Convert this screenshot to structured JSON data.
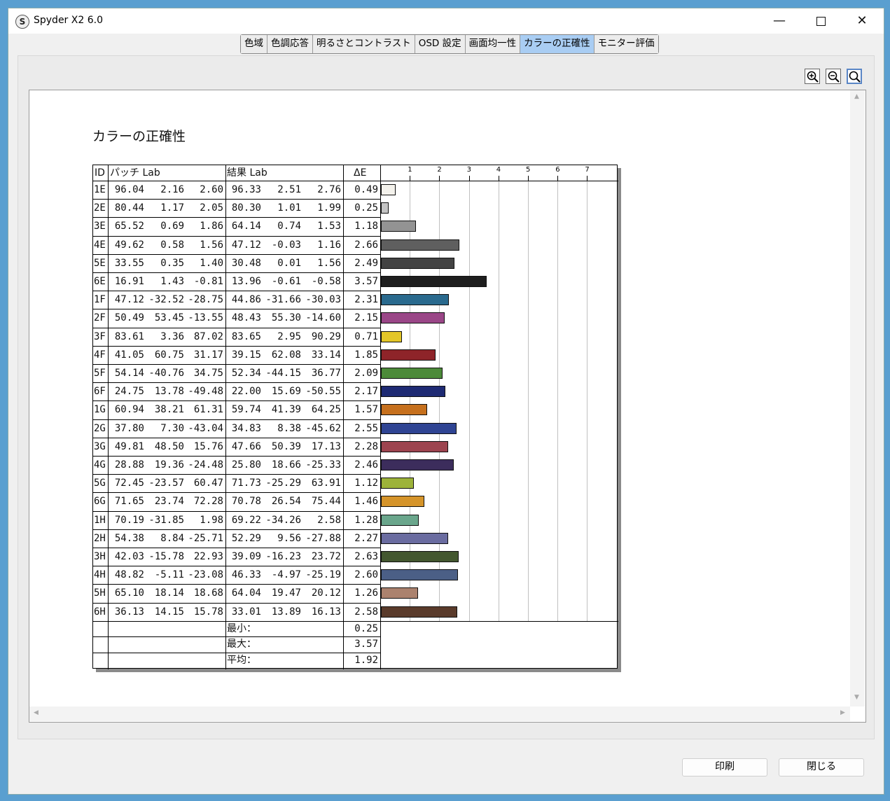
{
  "window": {
    "title": "Spyder X2 6.0",
    "app_icon": "S"
  },
  "tabs": [
    "色域",
    "色調応答",
    "明るさとコントラスト",
    "OSD 設定",
    "画面均一性",
    "カラーの正確性",
    "モニター評価"
  ],
  "active_tab": "カラーの正確性",
  "report": {
    "title": "カラーの正確性",
    "headers": {
      "id": "ID",
      "patch": "パッチ Lab",
      "result": "結果 Lab",
      "de": "ΔE"
    },
    "scale": {
      "ticks": [
        "1",
        "2",
        "3",
        "4",
        "5",
        "6",
        "7"
      ],
      "max": 7.5
    },
    "rows": [
      {
        "id": "1E",
        "p": [
          "96.04",
          "2.16",
          "2.60"
        ],
        "r": [
          "96.33",
          "2.51",
          "2.76"
        ],
        "de": "0.49",
        "color": "#f4f2ec"
      },
      {
        "id": "2E",
        "p": [
          "80.44",
          "1.17",
          "2.05"
        ],
        "r": [
          "80.30",
          "1.01",
          "1.99"
        ],
        "de": "0.25",
        "color": "#c4c4c4"
      },
      {
        "id": "3E",
        "p": [
          "65.52",
          "0.69",
          "1.86"
        ],
        "r": [
          "64.14",
          "0.74",
          "1.53"
        ],
        "de": "1.18",
        "color": "#939393"
      },
      {
        "id": "4E",
        "p": [
          "49.62",
          "0.58",
          "1.56"
        ],
        "r": [
          "47.12",
          "-0.03",
          "1.16"
        ],
        "de": "2.66",
        "color": "#5f5f5f"
      },
      {
        "id": "5E",
        "p": [
          "33.55",
          "0.35",
          "1.40"
        ],
        "r": [
          "30.48",
          "0.01",
          "1.56"
        ],
        "de": "2.49",
        "color": "#434343"
      },
      {
        "id": "6E",
        "p": [
          "16.91",
          "1.43",
          "-0.81"
        ],
        "r": [
          "13.96",
          "-0.61",
          "-0.58"
        ],
        "de": "3.57",
        "color": "#1e1e1e"
      },
      {
        "id": "1F",
        "p": [
          "47.12",
          "-32.52",
          "-28.75"
        ],
        "r": [
          "44.86",
          "-31.66",
          "-30.03"
        ],
        "de": "2.31",
        "color": "#2a6a8e"
      },
      {
        "id": "2F",
        "p": [
          "50.49",
          "53.45",
          "-13.55"
        ],
        "r": [
          "48.43",
          "55.30",
          "-14.60"
        ],
        "de": "2.15",
        "color": "#9a4687"
      },
      {
        "id": "3F",
        "p": [
          "83.61",
          "3.36",
          "87.02"
        ],
        "r": [
          "83.65",
          "2.95",
          "90.29"
        ],
        "de": "0.71",
        "color": "#e3c628"
      },
      {
        "id": "4F",
        "p": [
          "41.05",
          "60.75",
          "31.17"
        ],
        "r": [
          "39.15",
          "62.08",
          "33.14"
        ],
        "de": "1.85",
        "color": "#8e2429"
      },
      {
        "id": "5F",
        "p": [
          "54.14",
          "-40.76",
          "34.75"
        ],
        "r": [
          "52.34",
          "-44.15",
          "36.77"
        ],
        "de": "2.09",
        "color": "#4c8a39"
      },
      {
        "id": "6F",
        "p": [
          "24.75",
          "13.78",
          "-49.48"
        ],
        "r": [
          "22.00",
          "15.69",
          "-50.55"
        ],
        "de": "2.17",
        "color": "#1e2a73"
      },
      {
        "id": "1G",
        "p": [
          "60.94",
          "38.21",
          "61.31"
        ],
        "r": [
          "59.74",
          "41.39",
          "64.25"
        ],
        "de": "1.57",
        "color": "#c6701d"
      },
      {
        "id": "2G",
        "p": [
          "37.80",
          "7.30",
          "-43.04"
        ],
        "r": [
          "34.83",
          "8.38",
          "-45.62"
        ],
        "de": "2.55",
        "color": "#2f4493"
      },
      {
        "id": "3G",
        "p": [
          "49.81",
          "48.50",
          "15.76"
        ],
        "r": [
          "47.66",
          "50.39",
          "17.13"
        ],
        "de": "2.28",
        "color": "#9d444f"
      },
      {
        "id": "4G",
        "p": [
          "28.88",
          "19.36",
          "-24.48"
        ],
        "r": [
          "25.80",
          "18.66",
          "-25.33"
        ],
        "de": "2.46",
        "color": "#3c2d5c"
      },
      {
        "id": "5G",
        "p": [
          "72.45",
          "-23.57",
          "60.47"
        ],
        "r": [
          "71.73",
          "-25.29",
          "63.91"
        ],
        "de": "1.12",
        "color": "#9db33a"
      },
      {
        "id": "6G",
        "p": [
          "71.65",
          "23.74",
          "72.28"
        ],
        "r": [
          "70.78",
          "26.54",
          "75.44"
        ],
        "de": "1.46",
        "color": "#d5942a"
      },
      {
        "id": "1H",
        "p": [
          "70.19",
          "-31.85",
          "1.98"
        ],
        "r": [
          "69.22",
          "-34.26",
          "2.58"
        ],
        "de": "1.28",
        "color": "#6aa68c"
      },
      {
        "id": "2H",
        "p": [
          "54.38",
          "8.84",
          "-25.71"
        ],
        "r": [
          "52.29",
          "9.56",
          "-27.88"
        ],
        "de": "2.27",
        "color": "#6a6ca0"
      },
      {
        "id": "3H",
        "p": [
          "42.03",
          "-15.78",
          "22.93"
        ],
        "r": [
          "39.09",
          "-16.23",
          "23.72"
        ],
        "de": "2.63",
        "color": "#43572f"
      },
      {
        "id": "4H",
        "p": [
          "48.82",
          "-5.11",
          "-23.08"
        ],
        "r": [
          "46.33",
          "-4.97",
          "-25.19"
        ],
        "de": "2.60",
        "color": "#4b5f86"
      },
      {
        "id": "5H",
        "p": [
          "65.10",
          "18.14",
          "18.68"
        ],
        "r": [
          "64.04",
          "19.47",
          "20.12"
        ],
        "de": "1.26",
        "color": "#ab826e"
      },
      {
        "id": "6H",
        "p": [
          "36.13",
          "14.15",
          "15.78"
        ],
        "r": [
          "33.01",
          "13.89",
          "16.13"
        ],
        "de": "2.58",
        "color": "#5a3b2b"
      }
    ],
    "summary": [
      {
        "label": "最小：",
        "value": "0.25"
      },
      {
        "label": "最大：",
        "value": "3.57"
      },
      {
        "label": "平均：",
        "value": "1.92"
      }
    ]
  },
  "buttons": {
    "print": "印刷",
    "close": "閉じる"
  }
}
